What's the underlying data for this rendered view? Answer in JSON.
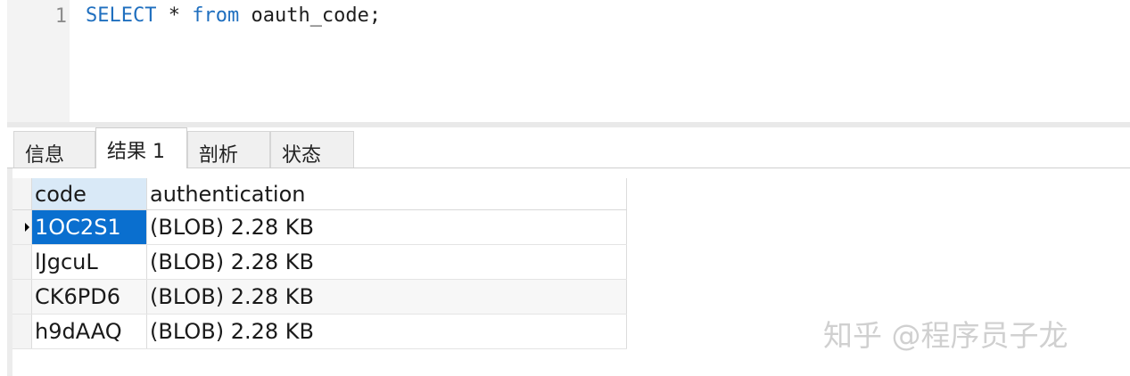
{
  "editor": {
    "line_number": "1",
    "keyword_select": "SELECT",
    "star": " * ",
    "keyword_from": "from",
    "rest": " oauth_code;"
  },
  "tabs": [
    {
      "label": "信息",
      "active": false
    },
    {
      "label": "结果 1",
      "active": true
    },
    {
      "label": "剖析",
      "active": false
    },
    {
      "label": "状态",
      "active": false
    }
  ],
  "grid": {
    "columns": [
      "code",
      "authentication"
    ],
    "rows": [
      {
        "code": "1OC2S1",
        "authentication": "(BLOB) 2.28 KB",
        "selected": true
      },
      {
        "code": "lJgcuL",
        "authentication": "(BLOB) 2.28 KB",
        "selected": false
      },
      {
        "code": "CK6PD6",
        "authentication": "(BLOB) 2.28 KB",
        "selected": false
      },
      {
        "code": "h9dAAQ",
        "authentication": "(BLOB) 2.28 KB",
        "selected": false
      }
    ]
  },
  "watermark": "知乎 @程序员子龙",
  "colors": {
    "keyword": "#1f6fbf",
    "selection": "#0a6fcf",
    "header_highlight": "#d9e9f7"
  }
}
